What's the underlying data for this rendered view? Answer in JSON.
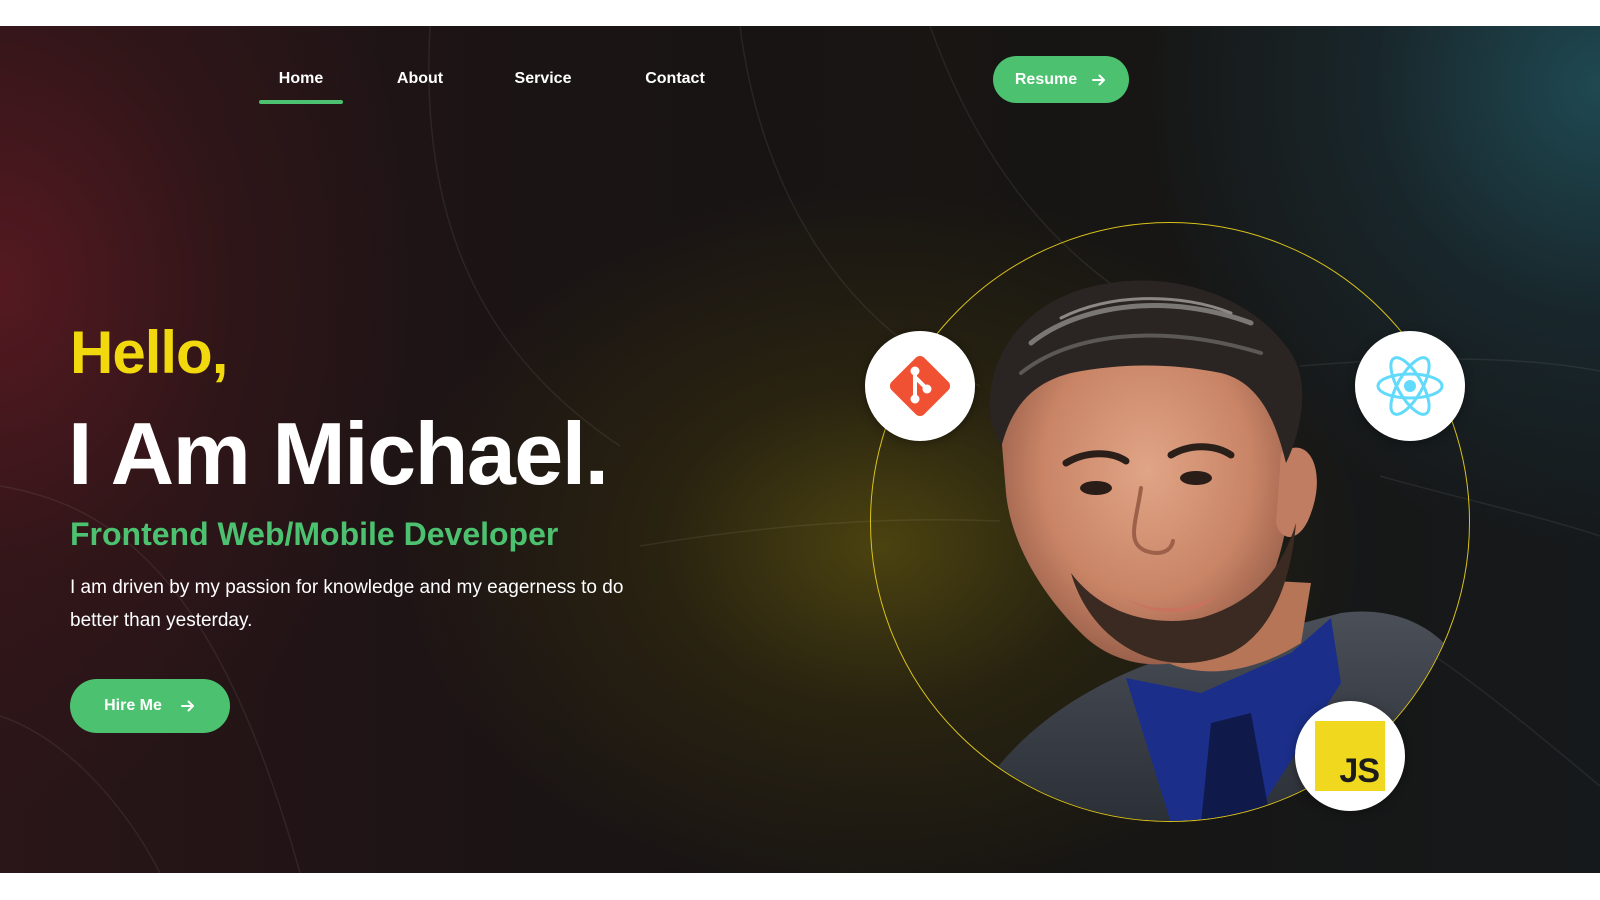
{
  "nav": {
    "items": [
      {
        "label": "Home",
        "active": true
      },
      {
        "label": "About",
        "active": false
      },
      {
        "label": "Service",
        "active": false
      },
      {
        "label": "Contact",
        "active": false
      }
    ],
    "resume_label": "Resume"
  },
  "hero": {
    "greeting": "Hello,",
    "name": "I Am Michael.",
    "role": "Frontend Web/Mobile Developer",
    "tagline": "I am driven by my passion for knowledge and my eagerness to do better than yesterday.",
    "hire_label": "Hire Me"
  },
  "tech_badges": [
    {
      "icon": "git-icon"
    },
    {
      "icon": "react-icon"
    },
    {
      "icon": "javascript-icon",
      "label": "JS"
    }
  ],
  "colors": {
    "accent_green": "#4cc16f",
    "greeting_yellow": "#f2d90d",
    "ring_gold": "#d9c21a",
    "git_orange": "#f05133",
    "react_blue": "#61dafb",
    "js_yellow": "#efd81d"
  }
}
